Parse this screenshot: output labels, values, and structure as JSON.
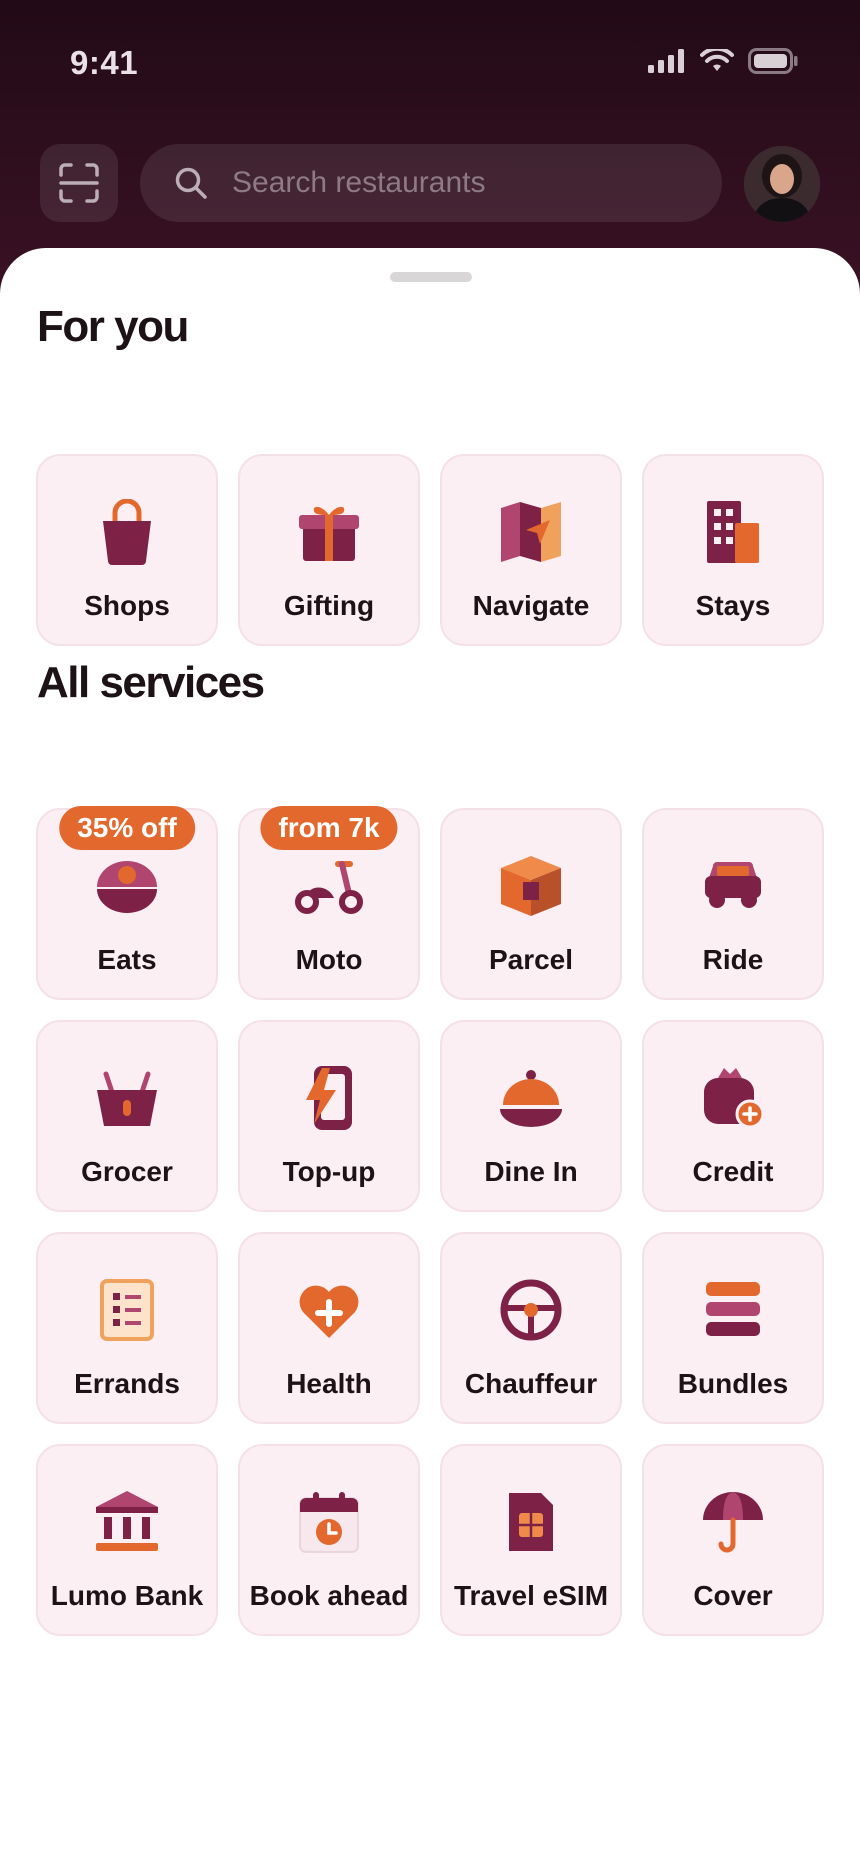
{
  "status_bar": {
    "time": "9:41"
  },
  "header": {
    "search_placeholder": "Search restaurants"
  },
  "sections": {
    "for_you": {
      "title": "For you",
      "items": [
        {
          "label": "Shops",
          "icon": "shopping-bag-icon"
        },
        {
          "label": "Gifting",
          "icon": "gift-icon"
        },
        {
          "label": "Navigate",
          "icon": "map-icon"
        },
        {
          "label": "Stays",
          "icon": "hotel-building-icon"
        }
      ]
    },
    "all_services": {
      "title": "All services",
      "items": [
        {
          "label": "Eats",
          "icon": "food-bowl-icon",
          "badge": "35% off"
        },
        {
          "label": "Moto",
          "icon": "scooter-icon",
          "badge": "from 7k"
        },
        {
          "label": "Parcel",
          "icon": "package-box-icon"
        },
        {
          "label": "Ride",
          "icon": "car-icon"
        },
        {
          "label": "Grocer",
          "icon": "basket-icon"
        },
        {
          "label": "Top-up",
          "icon": "phone-charge-icon"
        },
        {
          "label": "Dine In",
          "icon": "cloche-icon"
        },
        {
          "label": "Credit",
          "icon": "money-bag-plus-icon"
        },
        {
          "label": "Errands",
          "icon": "checklist-icon"
        },
        {
          "label": "Health",
          "icon": "heart-plus-icon"
        },
        {
          "label": "Chauffeur",
          "icon": "steering-wheel-icon"
        },
        {
          "label": "Bundles",
          "icon": "stacked-layers-icon"
        },
        {
          "label": "Lumo Bank",
          "icon": "bank-icon"
        },
        {
          "label": "Book ahead",
          "icon": "calendar-clock-icon"
        },
        {
          "label": "Travel eSIM",
          "icon": "sim-card-icon"
        },
        {
          "label": "Cover",
          "icon": "umbrella-icon"
        }
      ]
    }
  },
  "colors": {
    "header_bg": "#2a0c1a",
    "tile_bg": "#fbeff3",
    "brand_maroon": "#7d2147",
    "accent_orange": "#e2682d",
    "accent_pink": "#b0456f"
  }
}
